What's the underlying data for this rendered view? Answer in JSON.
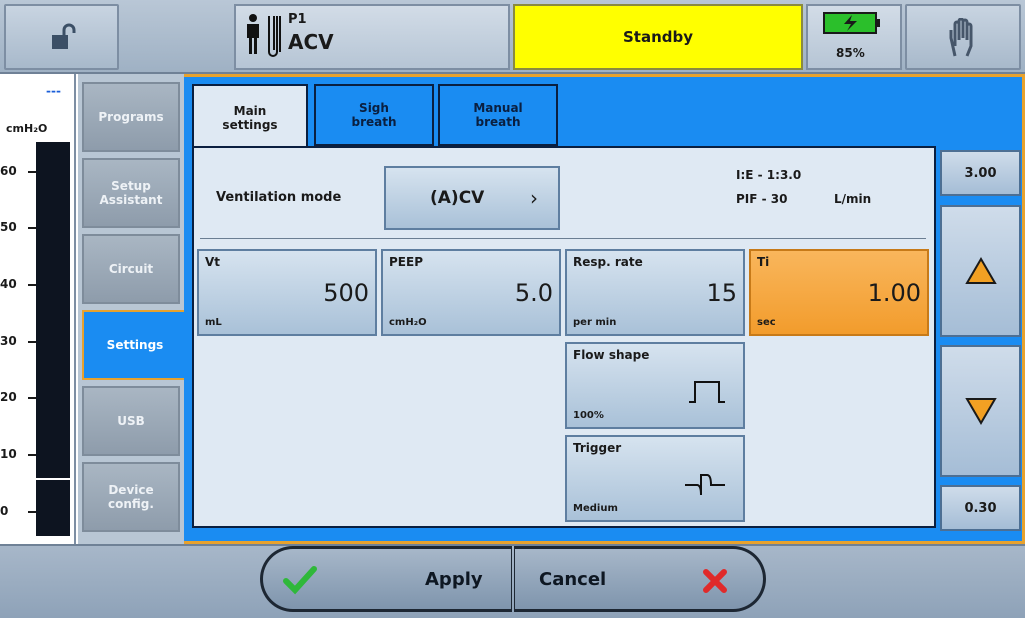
{
  "header": {
    "patient_id": "P1",
    "mode": "ACV",
    "status": "Standby",
    "battery_percent": "85%",
    "colors": {
      "status": "#ffff00",
      "battery": "#2bbf2b"
    }
  },
  "gauge": {
    "value": "---",
    "unit": "cmH₂O",
    "ticks": [
      "60",
      "50",
      "40",
      "30",
      "20",
      "10",
      "0"
    ]
  },
  "menu": {
    "items": [
      {
        "label": "Programs"
      },
      {
        "label": "Setup\nAssistant"
      },
      {
        "label": "Circuit"
      },
      {
        "label": "Settings",
        "active": true
      },
      {
        "label": "USB"
      },
      {
        "label": "Device\nconfig."
      }
    ]
  },
  "tabs": [
    {
      "label": "Main\nsettings",
      "active": true
    },
    {
      "label": "Sigh\nbreath"
    },
    {
      "label": "Manual\nbreath"
    }
  ],
  "ventilation": {
    "label": "Ventilation mode",
    "value": "(A)CV",
    "ie_label": "I:E - 1:3.0",
    "pif_label": "PIF - 30",
    "pif_unit": "L/min"
  },
  "params": {
    "vt": {
      "name": "Vt",
      "value": "500",
      "unit": "mL"
    },
    "peep": {
      "name": "PEEP",
      "value": "5.0",
      "unit": "cmH₂O"
    },
    "resp_rate": {
      "name": "Resp. rate",
      "value": "15",
      "unit": "per min"
    },
    "ti": {
      "name": "Ti",
      "value": "1.00",
      "unit": "sec"
    },
    "flow_shape": {
      "name": "Flow shape",
      "value": "100%"
    },
    "trigger": {
      "name": "Trigger",
      "value": "Medium"
    }
  },
  "limits": {
    "max": "3.00",
    "min": "0.30"
  },
  "footer": {
    "apply_label": "Apply",
    "cancel_label": "Cancel"
  }
}
